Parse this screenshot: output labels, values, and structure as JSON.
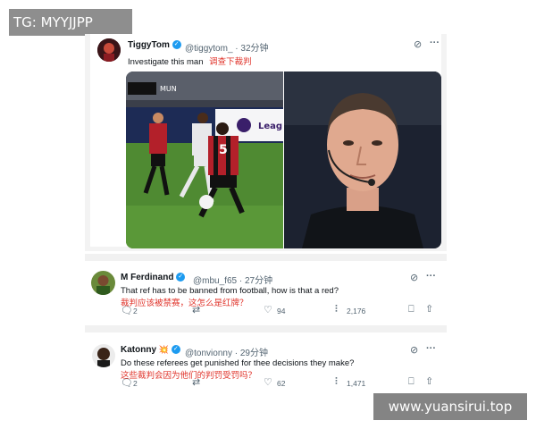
{
  "watermarks": {
    "top_left": "TG: MYYJJPP",
    "bottom_right": "www.yuansirui.top"
  },
  "tweets": [
    {
      "name": "TiggyTom",
      "handle": "@tiggytom_ · 32分钟",
      "text_en": "Investigate this man",
      "text_cn": "调查下裁判",
      "media": {
        "left_image": "football-match-photo",
        "right_image": "referee-portrait",
        "scoreboard": "MUN",
        "player_number": "5",
        "ad_board": "Leag"
      }
    },
    {
      "name": "M Ferdinand",
      "handle": "@mbu_f65 · 27分钟",
      "text_en": "That ref has to be banned from football, how is that a red?",
      "text_cn": "裁判应该被禁赛，这怎么是红牌？",
      "replies": "2",
      "retweets": "",
      "likes": "94",
      "views": "2,176"
    },
    {
      "name": "Katonny",
      "name_suffix": "💥",
      "handle": "@tonvionny · 29分钟",
      "text_en": "Do these referees get punished for thee decisions they make?",
      "text_cn": "这些裁判会因为他们的判罚受罚吗？",
      "replies": "2",
      "retweets": "",
      "likes": "62",
      "views": "1,471"
    }
  ],
  "icons": {
    "grok": "grok-icon",
    "more": "more-icon",
    "reply": "reply-icon",
    "retweet": "retweet-icon",
    "like": "like-icon",
    "views": "views-icon",
    "bookmark": "bookmark-icon",
    "share": "share-icon"
  },
  "colors": {
    "verified": "#1d9bf0",
    "translation": "#e0342b",
    "kit_red": "#b3202a",
    "pitch": "#4f8a32"
  }
}
